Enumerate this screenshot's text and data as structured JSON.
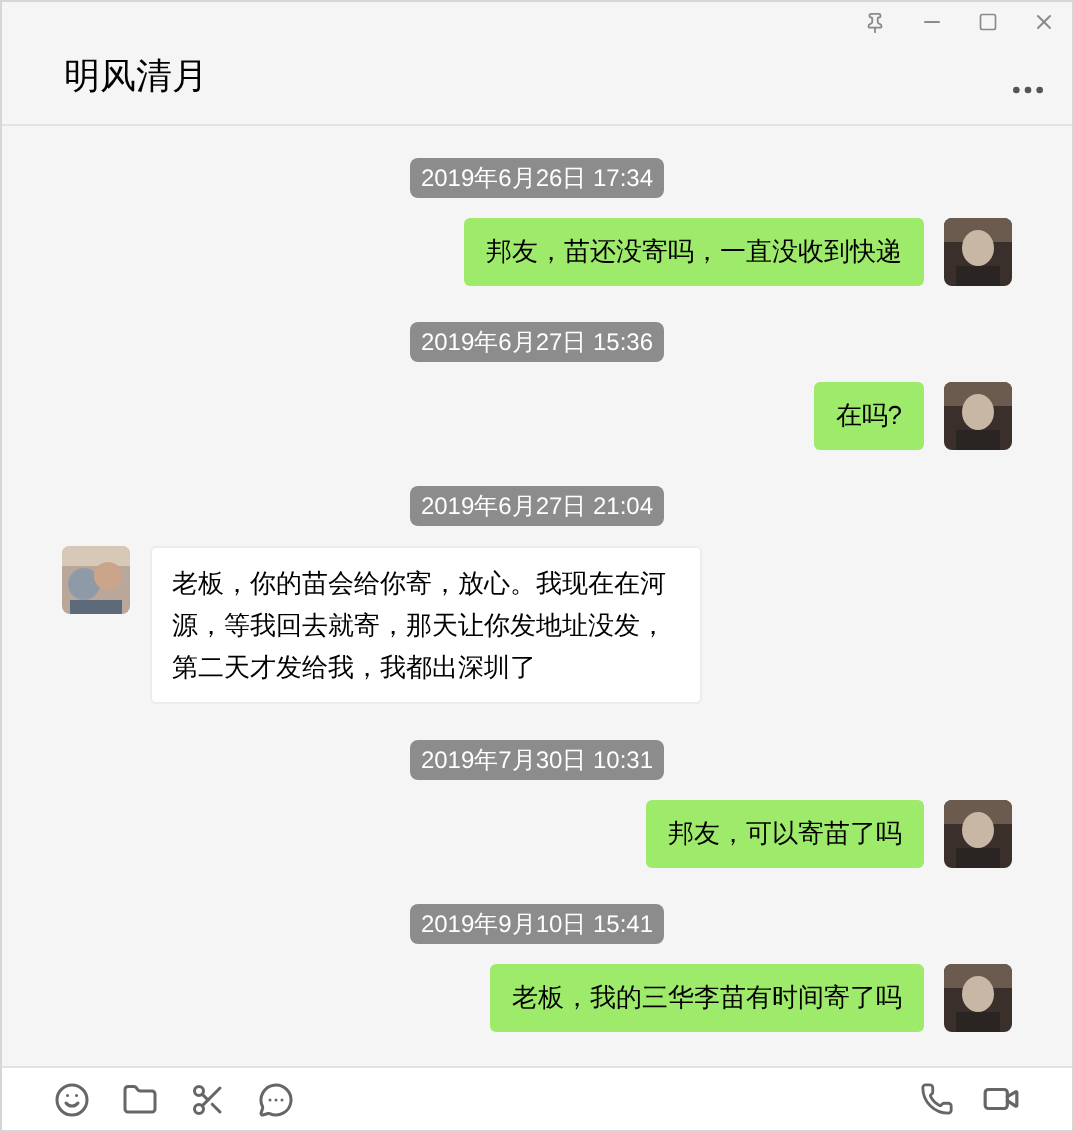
{
  "window": {
    "title": "明风清月"
  },
  "messages": [
    {
      "kind": "time",
      "text": "2019年6月26日 17:34"
    },
    {
      "kind": "sent",
      "text": "邦友，苗还没寄吗，一直没收到快递"
    },
    {
      "kind": "time",
      "text": "2019年6月27日 15:36"
    },
    {
      "kind": "sent",
      "text": "在吗?"
    },
    {
      "kind": "time",
      "text": "2019年6月27日 21:04"
    },
    {
      "kind": "received",
      "text": "老板，你的苗会给你寄，放心。我现在在河源，等我回去就寄，那天让你发地址没发，第二天才发给我，我都出深圳了"
    },
    {
      "kind": "time",
      "text": "2019年7月30日 10:31"
    },
    {
      "kind": "sent",
      "text": "邦友，可以寄苗了吗"
    },
    {
      "kind": "time",
      "text": "2019年9月10日 15:41"
    },
    {
      "kind": "sent",
      "text": "老板，我的三华李苗有时间寄了吗"
    }
  ]
}
